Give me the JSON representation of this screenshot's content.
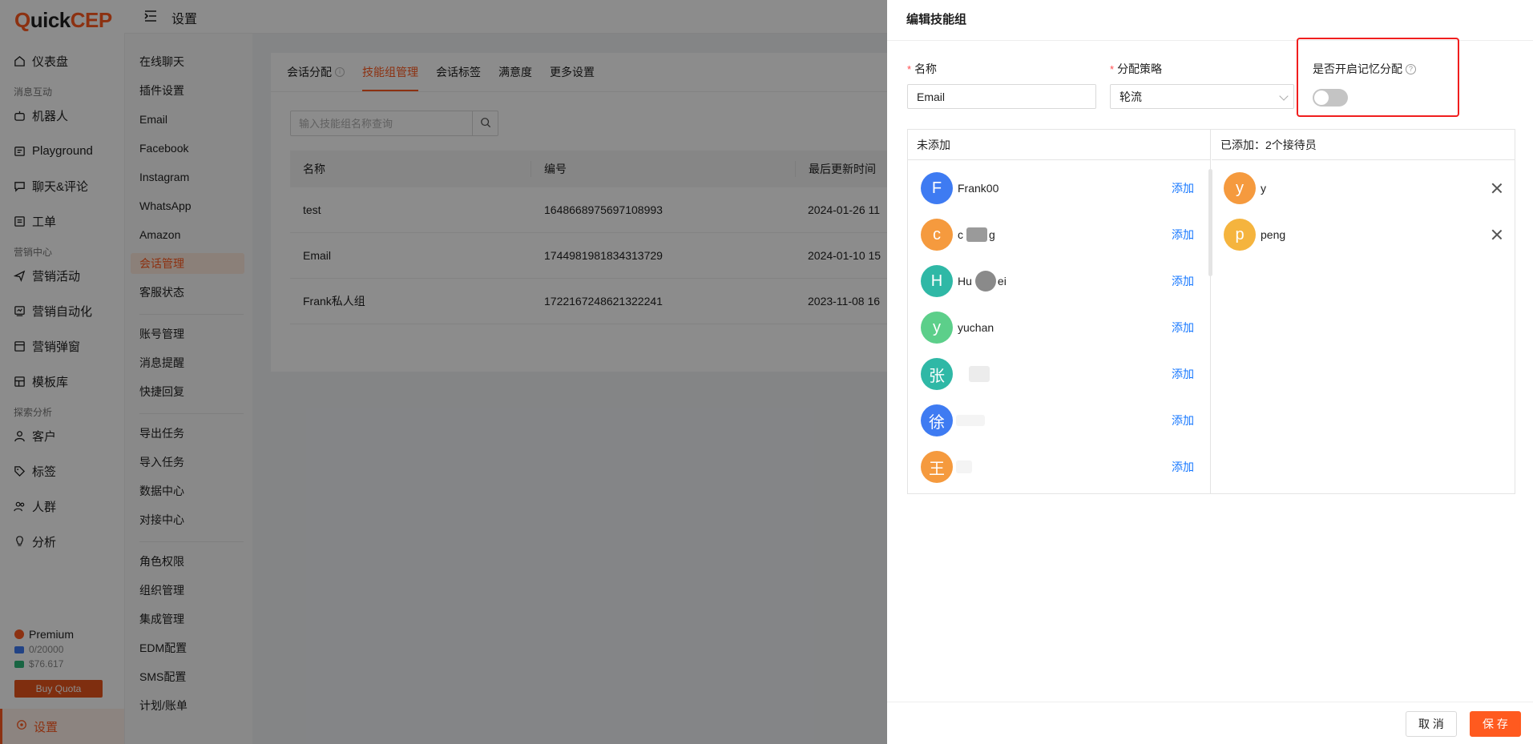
{
  "app": {
    "logo": {
      "q": "Q",
      "uick": "uick",
      "cep": "CEP"
    },
    "header_title": "设置"
  },
  "nav": {
    "items": [
      {
        "label": "仪表盘",
        "icon": "home-icon"
      },
      {
        "group": "消息互动"
      },
      {
        "label": "机器人",
        "icon": "robot-icon"
      },
      {
        "label": "Playground",
        "icon": "playground-icon"
      },
      {
        "label": "聊天&评论",
        "icon": "chat-icon"
      },
      {
        "label": "工单",
        "icon": "ticket-icon"
      },
      {
        "group": "营销中心"
      },
      {
        "label": "营销活动",
        "icon": "send-icon"
      },
      {
        "label": "营销自动化",
        "icon": "automation-icon"
      },
      {
        "label": "营销弹窗",
        "icon": "popup-icon"
      },
      {
        "label": "模板库",
        "icon": "template-icon"
      },
      {
        "group": "探索分析"
      },
      {
        "label": "客户",
        "icon": "user-icon"
      },
      {
        "label": "标签",
        "icon": "tag-icon"
      },
      {
        "label": "人群",
        "icon": "group-icon"
      },
      {
        "label": "分析",
        "icon": "bulb-icon"
      }
    ],
    "plan": {
      "name": "Premium",
      "quota": "0/20000",
      "balance": "$76.617",
      "buy_label": "Buy Quota"
    },
    "settings_label": "设置"
  },
  "subnav": {
    "items": [
      "在线聊天",
      "插件设置",
      "Email",
      "Facebook",
      "Instagram",
      "WhatsApp",
      "Amazon",
      "会话管理",
      "客服状态",
      "账号管理",
      "消息提醒",
      "快捷回复",
      "导出任务",
      "导入任务",
      "数据中心",
      "对接中心",
      "角色权限",
      "组织管理",
      "集成管理",
      "EDM配置",
      "SMS配置",
      "计划/账单"
    ],
    "active": "会话管理"
  },
  "main": {
    "tabs": [
      "会话分配",
      "技能组管理",
      "会话标签",
      "满意度",
      "更多设置"
    ],
    "active_tab": "技能组管理",
    "search_placeholder": "输入技能组名称查询",
    "columns": [
      "名称",
      "编号",
      "最后更新时间"
    ],
    "rows": [
      {
        "name": "test",
        "id": "1648668975697108993",
        "updated": "2024-01-26 11"
      },
      {
        "name": "Email",
        "id": "1744981981834313729",
        "updated": "2024-01-10 15"
      },
      {
        "name": "Frank私人组",
        "id": "1722167248621322241",
        "updated": "2023-11-08 16"
      }
    ]
  },
  "drawer": {
    "title": "编辑技能组",
    "name_label": "名称",
    "name_value": "Email",
    "strategy_label": "分配策略",
    "strategy_value": "轮流",
    "memory_label": "是否开启记忆分配",
    "memory_enabled": false,
    "left_header": "未添加",
    "right_header": "已添加：2个接待员",
    "add_label": "添加",
    "unadded": [
      {
        "initial": "F",
        "name": "Frank00",
        "color": "#3e7bf2"
      },
      {
        "initial": "c",
        "name": "c",
        "name_tail": "g",
        "color": "#f59a3e"
      },
      {
        "initial": "H",
        "name": "Hu",
        "name_tail": "ei",
        "color": "#2fb8a6"
      },
      {
        "initial": "y",
        "name": "yuchan",
        "color": "#5ccf8a"
      },
      {
        "initial": "张",
        "name": "",
        "color": "#2fb8a6"
      },
      {
        "initial": "徐",
        "name": "",
        "color": "#3e7bf2"
      },
      {
        "initial": "王",
        "name": "",
        "color": "#f59a3e"
      }
    ],
    "added": [
      {
        "initial": "y",
        "name": "y",
        "color": "#f59a3e"
      },
      {
        "initial": "p",
        "name": "peng",
        "color": "#f5b43e"
      }
    ],
    "cancel_label": "取 消",
    "save_label": "保 存"
  },
  "colors": {
    "accent": "#ff5a1f",
    "link": "#1677ff",
    "highlight": "#f01e1e"
  }
}
